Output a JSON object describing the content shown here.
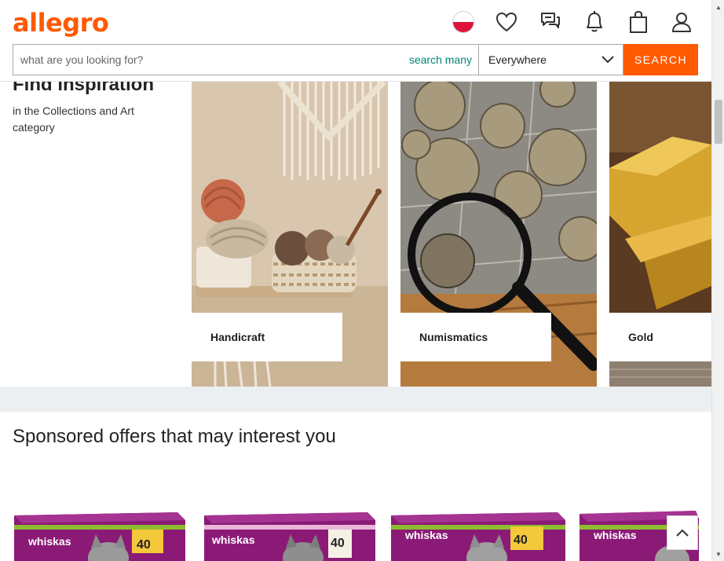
{
  "header": {
    "logo": "allegro",
    "icons": [
      "poland-flag-icon",
      "heart-icon",
      "chat-icon",
      "bell-icon",
      "shopping-bag-icon",
      "user-icon"
    ]
  },
  "search": {
    "placeholder": "what are you looking for?",
    "search_many": "search many",
    "scope": "Everywhere",
    "button": "SEARCH"
  },
  "inspiration": {
    "title": "Find inspiration",
    "subtitle": "in the Collections and Art category",
    "tiles": [
      {
        "label": "Handicraft"
      },
      {
        "label": "Numismatics"
      },
      {
        "label": "Gold"
      }
    ]
  },
  "sponsored": {
    "title": "Sponsored offers that may interest you",
    "products": [
      {
        "brand": "whiskas",
        "badge": "40"
      },
      {
        "brand": "whiskas",
        "badge": "40"
      },
      {
        "brand": "whiskas",
        "badge": "40"
      },
      {
        "brand": "whiskas",
        "badge": ""
      }
    ]
  },
  "colors": {
    "brand_orange": "#ff5a00",
    "link_teal": "#008673",
    "whiskas_purple": "#8b1a77"
  }
}
